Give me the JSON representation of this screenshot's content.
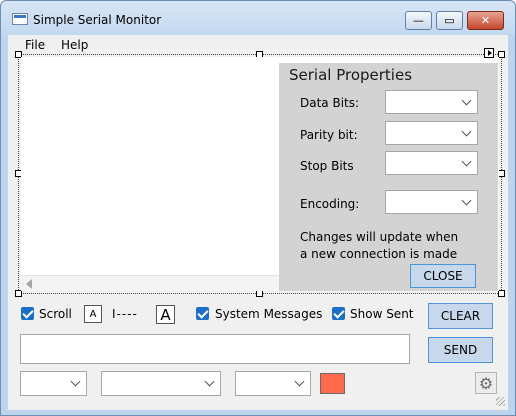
{
  "window": {
    "title": "Simple Serial Monitor",
    "minimize_glyph": "—",
    "maximize_glyph": "▭",
    "close_glyph": "✕"
  },
  "menu": {
    "items": [
      "File",
      "Help"
    ]
  },
  "serial_properties": {
    "title": "Serial Properties",
    "fields": [
      {
        "label": "Data Bits:",
        "value": ""
      },
      {
        "label": "Parity bit:",
        "value": ""
      },
      {
        "label": "Stop Bits",
        "value": ""
      },
      {
        "label": "Encoding:",
        "value": ""
      }
    ],
    "note_line1": "Changes will update when",
    "note_line2": "a new connection is made",
    "close_label": "CLOSE"
  },
  "options": {
    "scroll_label": "Scroll",
    "scroll_checked": true,
    "font_small_glyph": "A",
    "font_large_glyph": "A",
    "font_slider_text": "I----",
    "system_messages_label": "System Messages",
    "system_messages_checked": true,
    "show_sent_label": "Show Sent",
    "show_sent_checked": true,
    "clear_label": "CLEAR"
  },
  "send": {
    "input_value": "",
    "button_label": "SEND"
  },
  "bottom": {
    "combo1_value": "",
    "combo2_value": "",
    "combo3_value": "",
    "color": "#ff6a4d",
    "settings_icon": "gear-icon",
    "settings_glyph": "⚙"
  }
}
